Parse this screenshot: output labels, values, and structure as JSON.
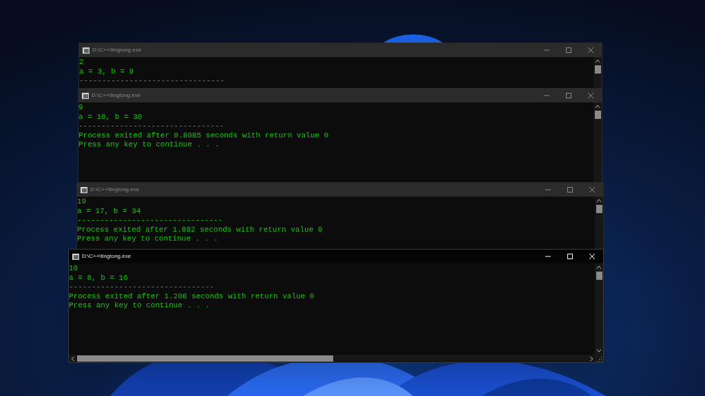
{
  "windows": [
    {
      "title": "D:\\C++\\tingtong.exe",
      "active": false,
      "lines": [
        "2",
        "a = 3, b = 9",
        "--------------------------------"
      ]
    },
    {
      "title": "D:\\C++\\tingtong.exe",
      "active": false,
      "lines": [
        "9",
        "a = 10, b = 30",
        "--------------------------------",
        "Process exited after 0.8085 seconds with return value 0",
        "Press any key to continue . . ."
      ]
    },
    {
      "title": "D:\\C++\\tingtong.exe",
      "active": false,
      "lines": [
        "19",
        "a = 17, b = 34",
        "--------------------------------",
        "Process exited after 1.892 seconds with return value 0",
        "Press any key to continue . . ."
      ]
    },
    {
      "title": "D:\\C++\\tingtong.exe",
      "active": true,
      "lines": [
        "10",
        "a = 8, b = 16",
        "--------------------------------",
        "Process exited after 1.208 seconds with return value 0",
        "Press any key to continue . . ."
      ]
    }
  ]
}
